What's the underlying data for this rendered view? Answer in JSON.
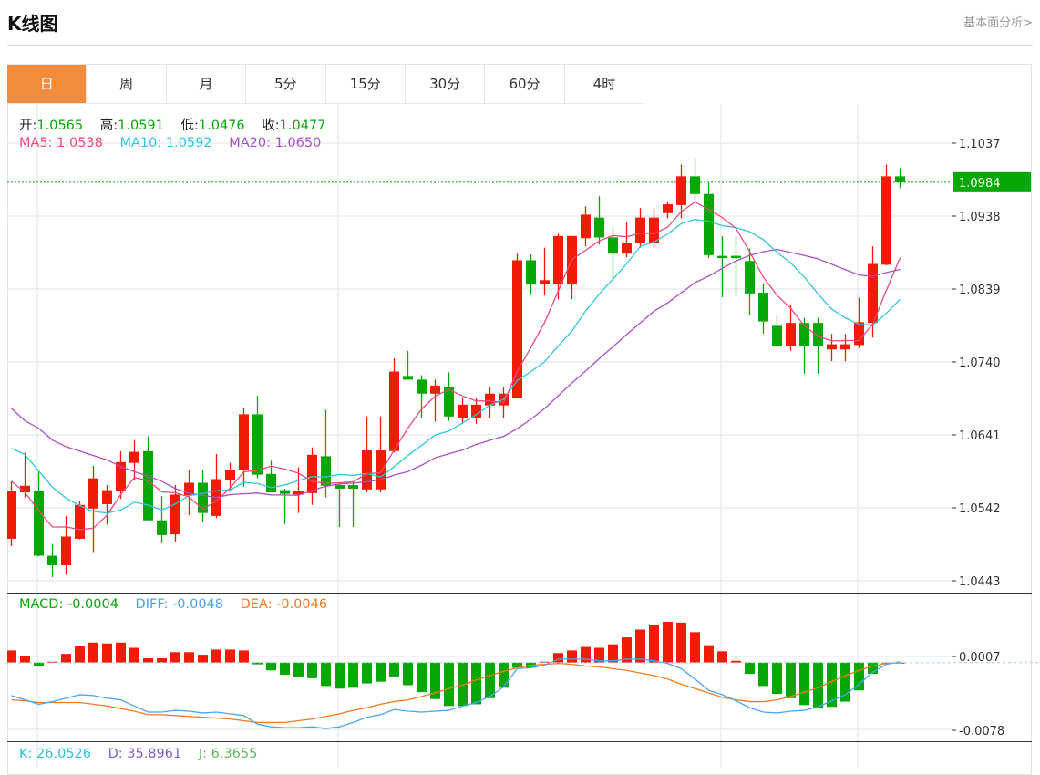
{
  "header": {
    "title": "K线图",
    "link": "基本面分析>"
  },
  "tabs": [
    "日",
    "周",
    "月",
    "5分",
    "15分",
    "30分",
    "60分",
    "4时"
  ],
  "active_tab": 0,
  "legend": {
    "ohlc": [
      {
        "label": "开:",
        "value": "1.0565"
      },
      {
        "label": "高:",
        "value": "1.0591"
      },
      {
        "label": "低:",
        "value": "1.0476"
      },
      {
        "label": "收:",
        "value": "1.0477"
      }
    ],
    "ma": [
      {
        "text": "MA5: 1.0538"
      },
      {
        "text": "MA10: 1.0592"
      },
      {
        "text": "MA20: 1.0650"
      }
    ]
  },
  "macd_legend": [
    {
      "text": "MACD: -0.0004"
    },
    {
      "text": "DIFF: -0.0048"
    },
    {
      "text": "DEA: -0.0046"
    }
  ],
  "kdj_legend": [
    {
      "text": "K: 26.0526"
    },
    {
      "text": "D: 35.8961"
    },
    {
      "text": "J: 6.3655"
    }
  ],
  "current_price": "1.0984",
  "colors": {
    "up": "#f21b05",
    "down": "#06a706",
    "ma5": "#ee4a80",
    "ma10": "#30c6e0",
    "ma20": "#ac4fc6",
    "diff": "#4aa6f0",
    "dea": "#f77a1c",
    "tab_active": "#f38b3c",
    "grid": "#e6edf3",
    "kdj_k": "#30c0d8",
    "kdj_d": "#8a5cc8",
    "kdj_j": "#5cbb5c",
    "macd": "#06a706"
  },
  "chart_data": [
    {
      "type": "candlestick",
      "title": "K线图",
      "ylim": [
        1.0443,
        1.1037
      ],
      "y_ticks": [
        "1.1037",
        "1.0938",
        "1.0839",
        "1.0740",
        "1.0641",
        "1.0542",
        "1.0443"
      ],
      "grid": true,
      "ohlc_order": [
        "open",
        "high",
        "low",
        "close"
      ],
      "candles": [
        [
          1.05,
          1.0578,
          1.049,
          1.0565
        ],
        [
          1.0563,
          1.0617,
          1.0556,
          1.0572
        ],
        [
          1.0565,
          1.0591,
          1.0476,
          1.0477
        ],
        [
          1.0477,
          1.0493,
          1.0448,
          1.0464
        ],
        [
          1.0464,
          1.0531,
          1.0451,
          1.0503
        ],
        [
          1.05,
          1.0551,
          1.0499,
          1.0546
        ],
        [
          1.0541,
          1.0599,
          1.0482,
          1.0582
        ],
        [
          1.0547,
          1.0573,
          1.0519,
          1.0566
        ],
        [
          1.0565,
          1.0619,
          1.0554,
          1.0604
        ],
        [
          1.0603,
          1.0634,
          1.058,
          1.0618
        ],
        [
          1.0619,
          1.0639,
          1.0525,
          1.0525
        ],
        [
          1.0525,
          1.0558,
          1.0494,
          1.0505
        ],
        [
          1.0506,
          1.0573,
          1.0495,
          1.056
        ],
        [
          1.0559,
          1.0593,
          1.0532,
          1.0576
        ],
        [
          1.0576,
          1.0593,
          1.0523,
          1.0535
        ],
        [
          1.0531,
          1.0615,
          1.0528,
          1.0581
        ],
        [
          1.058,
          1.0603,
          1.0565,
          1.0593
        ],
        [
          1.0593,
          1.0677,
          1.0571,
          1.0669
        ],
        [
          1.0669,
          1.0694,
          1.0582,
          1.0587
        ],
        [
          1.0588,
          1.0606,
          1.0563,
          1.0563
        ],
        [
          1.0566,
          1.0568,
          1.052,
          1.0561
        ],
        [
          1.056,
          1.0597,
          1.0535,
          1.0565
        ],
        [
          1.0562,
          1.0624,
          1.0546,
          1.0614
        ],
        [
          1.0612,
          1.0675,
          1.0556,
          1.0572
        ],
        [
          1.0573,
          1.0576,
          1.0516,
          1.0568
        ],
        [
          1.0573,
          1.0578,
          1.0516,
          1.0568
        ],
        [
          1.0567,
          1.0666,
          1.0563,
          1.062
        ],
        [
          1.0567,
          1.0666,
          1.0563,
          1.062
        ],
        [
          1.0619,
          1.0745,
          1.0617,
          1.0727
        ],
        [
          1.0721,
          1.0755,
          1.0716,
          1.0716
        ],
        [
          1.0716,
          1.0722,
          1.0664,
          1.0697
        ],
        [
          1.0697,
          1.0716,
          1.0659,
          1.0708
        ],
        [
          1.0706,
          1.0726,
          1.066,
          1.0666
        ],
        [
          1.0664,
          1.0692,
          1.0656,
          1.0682
        ],
        [
          1.0664,
          1.0691,
          1.0656,
          1.0682
        ],
        [
          1.0681,
          1.0706,
          1.0664,
          1.0697
        ],
        [
          1.0681,
          1.0706,
          1.0664,
          1.0697
        ],
        [
          1.0691,
          1.0887,
          1.0691,
          1.0878
        ],
        [
          1.0878,
          1.0886,
          1.0831,
          1.0845
        ],
        [
          1.0846,
          1.0895,
          1.083,
          1.0851
        ],
        [
          1.0845,
          1.0914,
          1.0825,
          1.0911
        ],
        [
          1.0845,
          1.0911,
          1.0825,
          1.0911
        ],
        [
          1.0908,
          1.0951,
          1.0897,
          1.094
        ],
        [
          1.0936,
          1.0965,
          1.0899,
          1.0909
        ],
        [
          1.0909,
          1.0923,
          1.0853,
          1.0887
        ],
        [
          1.0887,
          1.093,
          1.0882,
          1.0902
        ],
        [
          1.0901,
          1.0949,
          1.0895,
          1.0936
        ],
        [
          1.0901,
          1.0949,
          1.0895,
          1.0936
        ],
        [
          1.0942,
          1.0958,
          1.0935,
          1.0954
        ],
        [
          1.0953,
          1.1008,
          1.0935,
          1.0992
        ],
        [
          1.0992,
          1.1017,
          1.096,
          1.0968
        ],
        [
          1.0968,
          1.0983,
          1.0881,
          1.0885
        ],
        [
          1.0884,
          1.0911,
          1.0828,
          1.0881
        ],
        [
          1.0884,
          1.0911,
          1.0828,
          1.0881
        ],
        [
          1.0877,
          1.0894,
          1.0804,
          1.0833
        ],
        [
          1.0834,
          1.0847,
          1.0778,
          1.0795
        ],
        [
          1.0789,
          1.0804,
          1.0759,
          1.0762
        ],
        [
          1.0762,
          1.0817,
          1.0755,
          1.0793
        ],
        [
          1.0793,
          1.08,
          1.0724,
          1.0762
        ],
        [
          1.0793,
          1.08,
          1.0724,
          1.0762
        ],
        [
          1.0757,
          1.0778,
          1.0741,
          1.0764
        ],
        [
          1.0757,
          1.0778,
          1.0741,
          1.0764
        ],
        [
          1.0763,
          1.0827,
          1.0759,
          1.0794
        ],
        [
          1.0793,
          1.0897,
          1.0773,
          1.0873
        ],
        [
          1.0872,
          1.1008,
          1.0871,
          1.0992
        ],
        [
          1.0992,
          1.1003,
          1.0976,
          1.0984
        ]
      ],
      "ma_leading": {
        "ma5": [
          1.0578,
          1.0563,
          1.0538,
          1.0516
        ],
        "ma10": [
          1.0623,
          1.0614,
          1.0592,
          1.057,
          1.0555,
          1.0545,
          1.0537,
          1.0535,
          1.0539
        ],
        "ma20": [
          1.0677,
          1.066,
          1.065,
          1.0634,
          1.0625,
          1.0619,
          1.0613,
          1.0607,
          1.0598,
          1.0591,
          1.0585,
          1.0578,
          1.0568,
          1.0562,
          1.0559,
          1.0556,
          1.056,
          1.0561,
          1.0562
        ]
      },
      "series": [
        "MA5",
        "MA10",
        "MA20"
      ]
    },
    {
      "type": "bar",
      "title": "MACD",
      "y_ticks": [
        "0.0007",
        "-0.0078"
      ],
      "ylim": [
        -0.0078,
        0.0007
      ],
      "macd": [
        0.0014,
        0.0008,
        -0.0004,
        0.0001,
        0.001,
        0.0019,
        0.0023,
        0.0022,
        0.0023,
        0.0017,
        0.0005,
        0.0005,
        0.0012,
        0.0012,
        0.0009,
        0.0015,
        0.0015,
        0.0014,
        -0.0002,
        -0.0009,
        -0.0014,
        -0.0016,
        -0.0018,
        -0.0027,
        -0.003,
        -0.0029,
        -0.0024,
        -0.0022,
        -0.0016,
        -0.0026,
        -0.0034,
        -0.0042,
        -0.005,
        -0.005,
        -0.0048,
        -0.0041,
        -0.0029,
        -0.0006,
        -0.0006,
        0.0001,
        0.0011,
        0.0014,
        0.0018,
        0.0017,
        0.0021,
        0.0029,
        0.0038,
        0.0043,
        0.0047,
        0.0046,
        0.0035,
        0.002,
        0.0013,
        0.0002,
        -0.0013,
        -0.0027,
        -0.0036,
        -0.0041,
        -0.0049,
        -0.0053,
        -0.0051,
        -0.0045,
        -0.0032,
        -0.0013,
        -0.0001,
        0.0
      ],
      "diff": [
        -0.0038,
        -0.0043,
        -0.0048,
        -0.0045,
        -0.0041,
        -0.0037,
        -0.0038,
        -0.0041,
        -0.0043,
        -0.005,
        -0.0057,
        -0.0057,
        -0.0055,
        -0.0056,
        -0.0058,
        -0.0057,
        -0.0059,
        -0.0061,
        -0.0071,
        -0.0074,
        -0.0075,
        -0.0075,
        -0.0074,
        -0.0076,
        -0.0074,
        -0.0069,
        -0.0063,
        -0.006,
        -0.0054,
        -0.0056,
        -0.0057,
        -0.0056,
        -0.0055,
        -0.005,
        -0.0046,
        -0.0039,
        -0.0028,
        -0.0007,
        -0.0006,
        -0.0003,
        0.0004,
        0.0004,
        0.0004,
        0.0002,
        0.0002,
        0.0004,
        0.0004,
        0.0002,
        -0.0001,
        -0.0007,
        -0.0019,
        -0.0032,
        -0.0037,
        -0.0044,
        -0.0052,
        -0.0057,
        -0.0058,
        -0.0056,
        -0.0055,
        -0.0051,
        -0.0044,
        -0.0037,
        -0.0025,
        -0.0011,
        -0.0002,
        0.0001
      ],
      "dea": [
        -0.0043,
        -0.0044,
        -0.0046,
        -0.0046,
        -0.0046,
        -0.0046,
        -0.0048,
        -0.005,
        -0.0053,
        -0.0056,
        -0.006,
        -0.006,
        -0.0061,
        -0.0062,
        -0.0063,
        -0.0064,
        -0.0065,
        -0.0067,
        -0.0069,
        -0.0069,
        -0.0069,
        -0.0067,
        -0.0065,
        -0.0062,
        -0.0059,
        -0.0055,
        -0.0052,
        -0.0048,
        -0.0045,
        -0.0043,
        -0.0039,
        -0.0035,
        -0.003,
        -0.0026,
        -0.002,
        -0.0015,
        -0.001,
        -0.0006,
        -0.0003,
        -0.0002,
        -0.0001,
        -0.0002,
        -0.0004,
        -0.0005,
        -0.0007,
        -0.0009,
        -0.0012,
        -0.0015,
        -0.0019,
        -0.0025,
        -0.003,
        -0.0035,
        -0.004,
        -0.0043,
        -0.0045,
        -0.0045,
        -0.0043,
        -0.0039,
        -0.0034,
        -0.0029,
        -0.0022,
        -0.0015,
        -0.0009,
        -0.0004,
        -0.0001,
        0.0
      ]
    }
  ]
}
